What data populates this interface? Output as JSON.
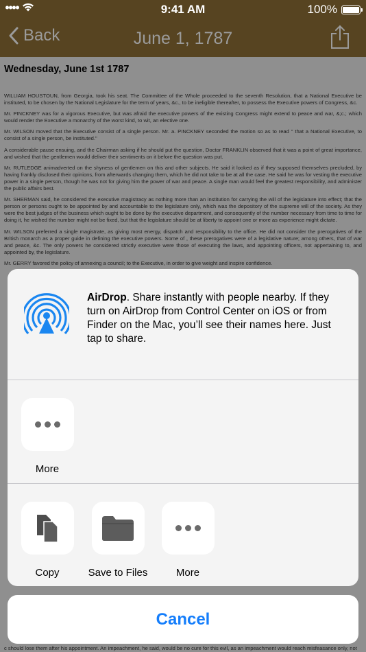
{
  "status_bar": {
    "time": "9:41 AM",
    "battery": "100%"
  },
  "nav": {
    "back_label": "Back",
    "title": "June 1, 1787"
  },
  "document": {
    "heading": "Wednesday, June 1st 1787",
    "paragraphs": [
      "WILLIAM HOUSTOUN, from Georgia, took his seat. The Committee of the Whole proceeded to the seventh Resolution, that a National Executive be instituted, to be chosen by the National Legislature for the term of years, &c., to be ineligible thereafter, to possess the Executive powers of Congress, &c.",
      "Mr. PINCKNEY was for a vigorous Executive, but was afraid the executive powers of the existing Congress might extend to peace and war, &;c.; which would render the Executive a monarchy of the worst kind, to wit, an elective one.",
      "Mr. WILSON moved that the Executive consist of a single person. Mr. a. PINCKNEY seconded the motion so as to read \" that a National Executive, to consist of a single person, be instituted.\"",
      "A considerable pause ensuing, and the Chairman asking if he should put the question, Doctor FRANKLIN observed that it was a point of great importance, and wished that the gentlemen would deliver their sentiments on it before the question was put.",
      "Mr. RUTLEDGE animadverted on the shyness of gentlemen on this and other subjects. He said it looked as if they supposed themselves precluded, by having frankly disclosed their opinions, from afterwards changing them, which he did not take to be at all the case. He said he was for vesting the executive power in a single person, though he was not for giving him the power of war and peace. A single man would feel the greatest responsibility, and administer the public affairs best.",
      "Mr. SHERMAN said, he considered the executive magistracy as nothing more than an institution for carrying the will of the legislature into effect; that the person or persons ought to be appointed by and accountable to the legislature only, which was the depository of the supreme will of the society. As they were the best judges of the business which ought to be done by the executive department, and consequently of the number necessary from time to time for doing it, he wished the number might not be fixed, but that the legislature should be at liberty to appoint one or more as experience might dictate.",
      "Mr. WILSON preferred a single magistrate, as giving most energy, dispatch and responsibility to the office. He did not consider the prerogatives of the British monarch as a proper guide in defining the executive powers. Some of , these prerogatives were of a legislative nature; among others, that of war and peace, &c. The only powers he considered strictly executive were those of executing the laws, and appointing officers, not appertaining to, and appointed by, the legislature.",
      "Mr. GERRY favored the policy of annexing a council; to the Executive, in order to give weight and inspire confidence."
    ],
    "bottom_line": "c should lose them after his appointment. An impeachment, he said, would be no cure for this evil, as an impeachment would reach misfeasance only, not"
  },
  "share_sheet": {
    "airdrop_title": "AirDrop",
    "airdrop_desc": ". Share instantly with people nearby. If they turn on AirDrop from Control Center on iOS or from Finder on the Mac, you’ll see their names here. Just tap to share.",
    "share_row": [
      {
        "label": "More",
        "icon": "more-dots-icon"
      }
    ],
    "action_row": [
      {
        "label": "Copy",
        "icon": "copy-icon"
      },
      {
        "label": "Save to Files",
        "icon": "folder-icon"
      },
      {
        "label": "More",
        "icon": "more-dots-icon"
      }
    ],
    "cancel_label": "Cancel"
  },
  "colors": {
    "accent": "#157efb",
    "nav_bg": "#574421",
    "sheet_bg": "#f4f4f4"
  }
}
